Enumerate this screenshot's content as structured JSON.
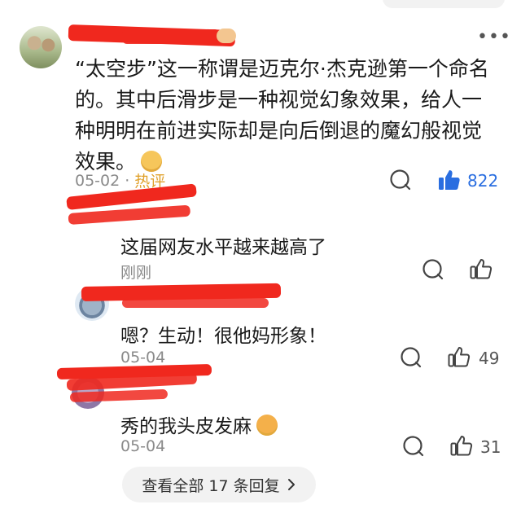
{
  "main_comment": {
    "text": "“太空步”这一称谓是迈克尔·杰克逊第一个命名的。其中后滑步是一种视觉幻象效果，给人一种明明在前进实际却是向后倒退的魔幻般视觉效果。",
    "date": "05-02",
    "separator": "·",
    "hot_label": "热评",
    "like_count": "822"
  },
  "replies": [
    {
      "text": "这届网友水平越来越高了",
      "time": "刚刚",
      "like_count": ""
    },
    {
      "text": "嗯？生动！很他妈形象！",
      "time": "05-04",
      "like_count": "49"
    },
    {
      "text": "秀的我头皮发麻",
      "time": "05-04",
      "like_count": "31"
    }
  ],
  "view_all": {
    "label": "查看全部 17 条回复"
  },
  "icons": {
    "more": "more-dots-icon",
    "comment": "comment-bubble-icon",
    "like": "thumbs-up-icon",
    "like_active_color": "#2a6ee0"
  }
}
